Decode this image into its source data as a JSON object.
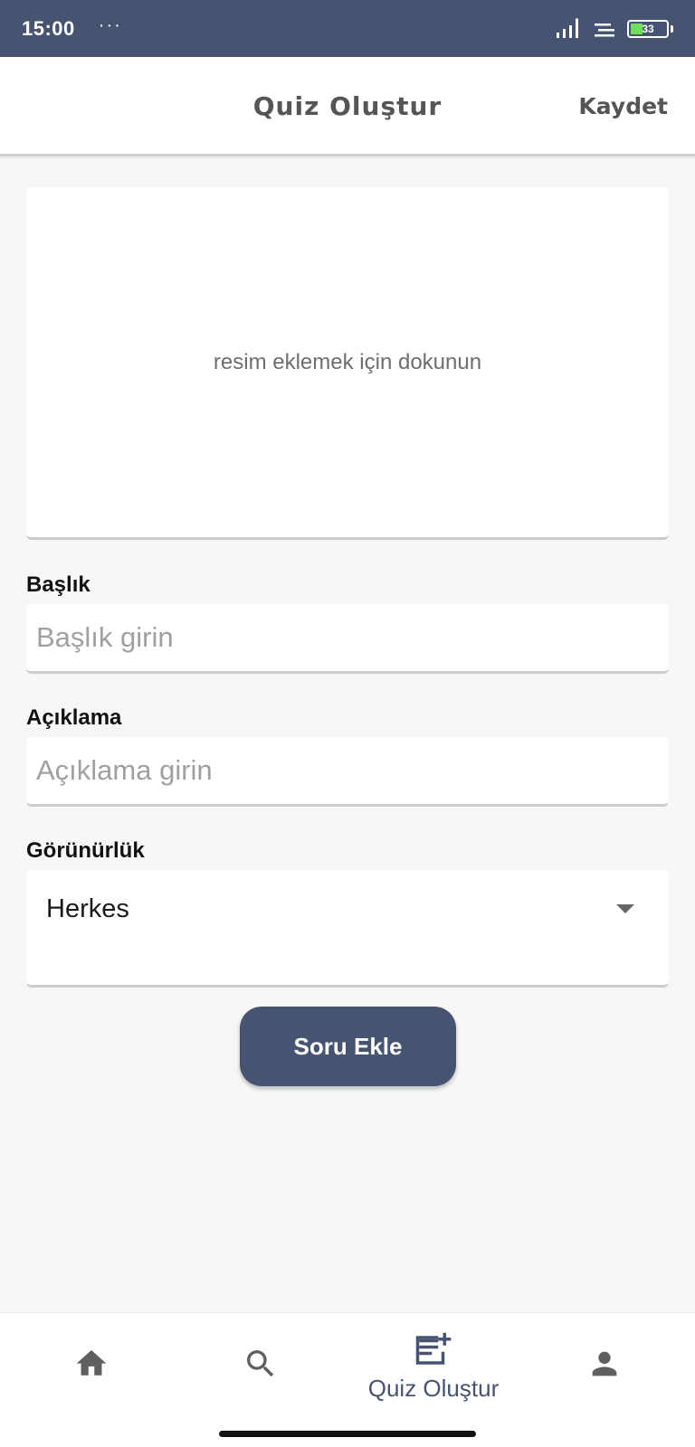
{
  "status_bar": {
    "time": "15:00",
    "dots": "···",
    "battery": "33",
    "icons": [
      "signal-icon",
      "wifi-icon",
      "battery-icon"
    ]
  },
  "app_bar": {
    "title": "Quiz Oluştur",
    "save_label": "Kaydet"
  },
  "image_picker": {
    "hint": "resim eklemek için dokunun"
  },
  "form": {
    "title_label": "Başlık",
    "title_placeholder": "Başlık girin",
    "title_value": "",
    "description_label": "Açıklama",
    "description_placeholder": "Açıklama girin",
    "description_value": "",
    "visibility_label": "Görünürlük",
    "visibility_selected": "Herkes"
  },
  "add_question_label": "Soru Ekle",
  "bottom_nav": {
    "items": [
      {
        "icon": "home-icon",
        "label": ""
      },
      {
        "icon": "search-icon",
        "label": ""
      },
      {
        "icon": "note-add-icon",
        "label": "Quiz Oluştur",
        "active": true
      },
      {
        "icon": "person-icon",
        "label": ""
      }
    ]
  },
  "colors": {
    "primary": "#465371",
    "background": "#f7f7f7",
    "surface": "#ffffff",
    "icon_inactive": "#5f5f5f",
    "battery_fill": "#6ee05a"
  }
}
